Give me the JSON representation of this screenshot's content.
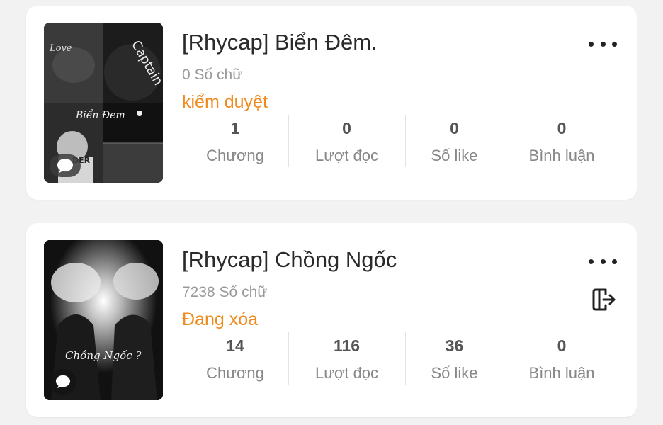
{
  "stories": [
    {
      "title": "[Rhycap] Biển Đêm.",
      "word_count": "0 Số chữ",
      "status": "kiểm duyệt",
      "stats": [
        {
          "value": "1",
          "label": "Chương"
        },
        {
          "value": "0",
          "label": "Lượt đọc"
        },
        {
          "value": "0",
          "label": "Số like"
        },
        {
          "value": "0",
          "label": "Bình luận"
        }
      ],
      "cover_texts": [
        "Love",
        "Captain",
        "Biển Đem",
        "DER"
      ]
    },
    {
      "title": "[Rhycap] Chồng Ngốc",
      "word_count": "7238 Số chữ",
      "status": "Đang xóa",
      "stats": [
        {
          "value": "14",
          "label": "Chương"
        },
        {
          "value": "116",
          "label": "Lượt đọc"
        },
        {
          "value": "36",
          "label": "Số like"
        },
        {
          "value": "0",
          "label": "Bình luận"
        }
      ],
      "cover_texts": [
        "Chồng Ngốc ?"
      ]
    }
  ],
  "colors": {
    "status": "#f08a1c",
    "title": "#2a2a2a",
    "muted": "#9a9a9a"
  },
  "icons": {
    "more": "more-horizontal-icon",
    "exit": "exit-icon",
    "comment": "chat-bubble-icon"
  }
}
